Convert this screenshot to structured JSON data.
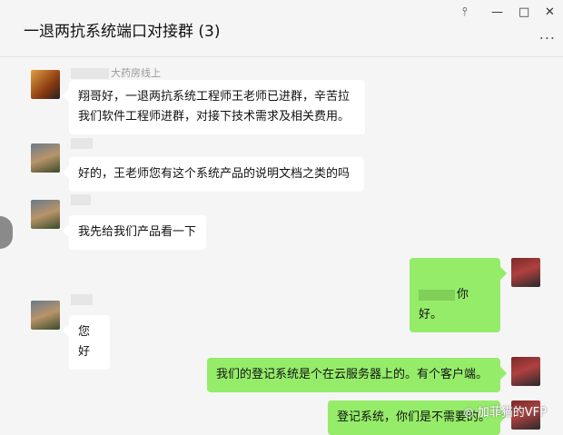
{
  "window": {
    "title": "一退两抗系统端口对接群 (3)",
    "pin_icon": "pin-icon",
    "more_label": "..."
  },
  "messages": [
    {
      "sender": "大药房线上",
      "text": "翔哥好，一退两抗系统工程师王老师已进群，辛苦拉\n我们软件工程师进群，对接下技术需求及相关费用。"
    },
    {
      "sender": "",
      "text": "好的，王老师您有这个系统产品的说明文档之类的吗"
    },
    {
      "sender": "",
      "text": "我先给我们产品看一下"
    },
    {
      "text": "你好。"
    },
    {
      "sender": "",
      "text": "您好"
    },
    {
      "text": "我们的登记系统是个在云服务器上的。有个客户端。"
    },
    {
      "text": "登记系统，你们是不需要的。"
    }
  ],
  "watermark": {
    "text": "加菲猫的VFP"
  }
}
